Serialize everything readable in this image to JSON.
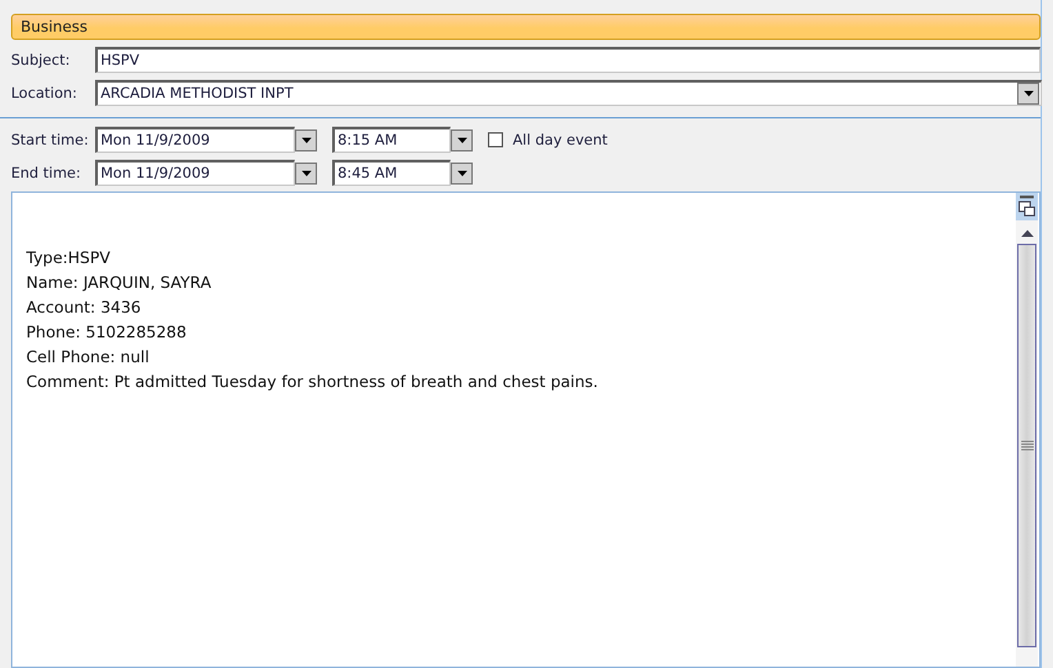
{
  "category": {
    "label": "Business",
    "color": "#ffcc66"
  },
  "subject": {
    "label": "Subject:",
    "value": "HSPV"
  },
  "location": {
    "label": "Location:",
    "value": "ARCADIA METHODIST INPT"
  },
  "start": {
    "label": "Start time:",
    "date": "Mon 11/9/2009",
    "time": "8:15 AM"
  },
  "end": {
    "label": "End time:",
    "date": "Mon 11/9/2009",
    "time": "8:45 AM"
  },
  "all_day": {
    "label": "All day event",
    "checked": false
  },
  "body": {
    "lines": [
      "Type:HSPV",
      "Name: JARQUIN, SAYRA",
      "Account: 3436",
      "Phone: 5102285288",
      "Cell Phone: null",
      "Comment: Pt admitted Tuesday for shortness of breath and chest pains."
    ]
  }
}
